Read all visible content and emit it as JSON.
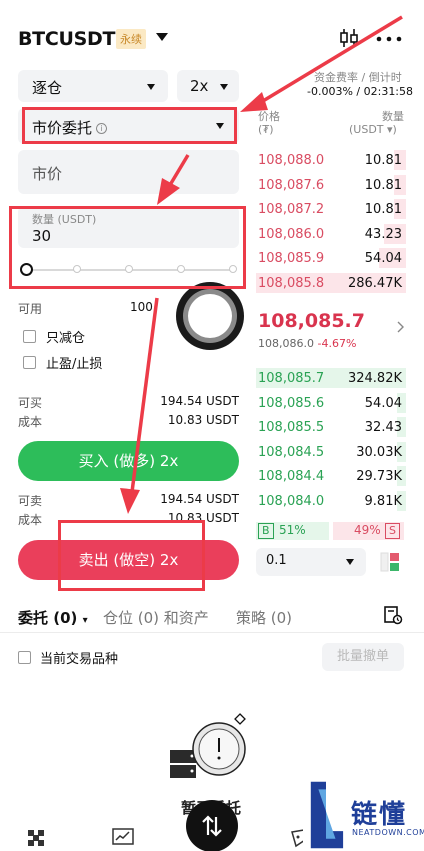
{
  "header": {
    "pair": "BTCUSDT",
    "perp_badge": "永续"
  },
  "form": {
    "margin_mode": "逐仓",
    "leverage": "2x",
    "order_type": "市价委托",
    "price_placeholder": "市价",
    "qty_label": "数量 (USDT)",
    "qty_value": "30",
    "available_label": "可用",
    "available_value": "100",
    "reduce_only": "只减仓",
    "tp_sl": "止盈/止损",
    "buy_max_label": "可买",
    "buy_max_value": "194.54 USDT",
    "buy_cost_label": "成本",
    "buy_cost_value": "10.83 USDT",
    "buy_button": "买入 (做多) 2x",
    "sell_max_label": "可卖",
    "sell_max_value": "194.54 USDT",
    "sell_cost_label": "成本",
    "sell_cost_value": "10.83 USDT",
    "sell_button": "卖出 (做空) 2x"
  },
  "funding": {
    "label": "资金费率 / 倒计时",
    "value": "-0.003% / 02:31:58"
  },
  "orderbook": {
    "price_header": "价格",
    "price_unit": "(₮)",
    "qty_header": "数量",
    "qty_unit": "(USDT ▾)",
    "asks": [
      {
        "price": "108,088.0",
        "qty": "10.81",
        "depth": 0.08
      },
      {
        "price": "108,087.6",
        "qty": "10.81",
        "depth": 0.08
      },
      {
        "price": "108,087.2",
        "qty": "10.81",
        "depth": 0.08
      },
      {
        "price": "108,086.0",
        "qty": "43.23",
        "depth": 0.15
      },
      {
        "price": "108,085.9",
        "qty": "54.04",
        "depth": 0.18
      },
      {
        "price": "108,085.8",
        "qty": "286.47K",
        "depth": 1.0
      }
    ],
    "last_price": "108,085.7",
    "mark_price": "108,086.0",
    "change": "-4.67%",
    "bids": [
      {
        "price": "108,085.7",
        "qty": "324.82K",
        "depth": 1.0
      },
      {
        "price": "108,085.6",
        "qty": "54.04",
        "depth": 0.06
      },
      {
        "price": "108,085.5",
        "qty": "32.43",
        "depth": 0.06
      },
      {
        "price": "108,084.5",
        "qty": "30.03K",
        "depth": 0.06
      },
      {
        "price": "108,084.4",
        "qty": "29.73K",
        "depth": 0.06
      },
      {
        "price": "108,084.0",
        "qty": "9.81K",
        "depth": 0.06
      }
    ],
    "buy_ratio_label": "B",
    "buy_ratio": "51%",
    "sell_ratio": "49%",
    "sell_ratio_label": "S",
    "buy_ratio_value": 0.51,
    "precision": "0.1"
  },
  "tabs": {
    "orders": "委托 (0)",
    "positions": "仓位 (0) 和资产",
    "strategy": "策略 (0)"
  },
  "filter": {
    "current_symbol": "当前交易品种",
    "batch_cancel": "批量撤单"
  },
  "empty_state": {
    "text": "暂无委托"
  },
  "watermark": {
    "brand": "链懂",
    "url": "NEATDOWN.COM"
  },
  "colors": {
    "buy": "#2dbd5a",
    "sell": "#ea3f5b",
    "annotation": "#ec3b48"
  }
}
